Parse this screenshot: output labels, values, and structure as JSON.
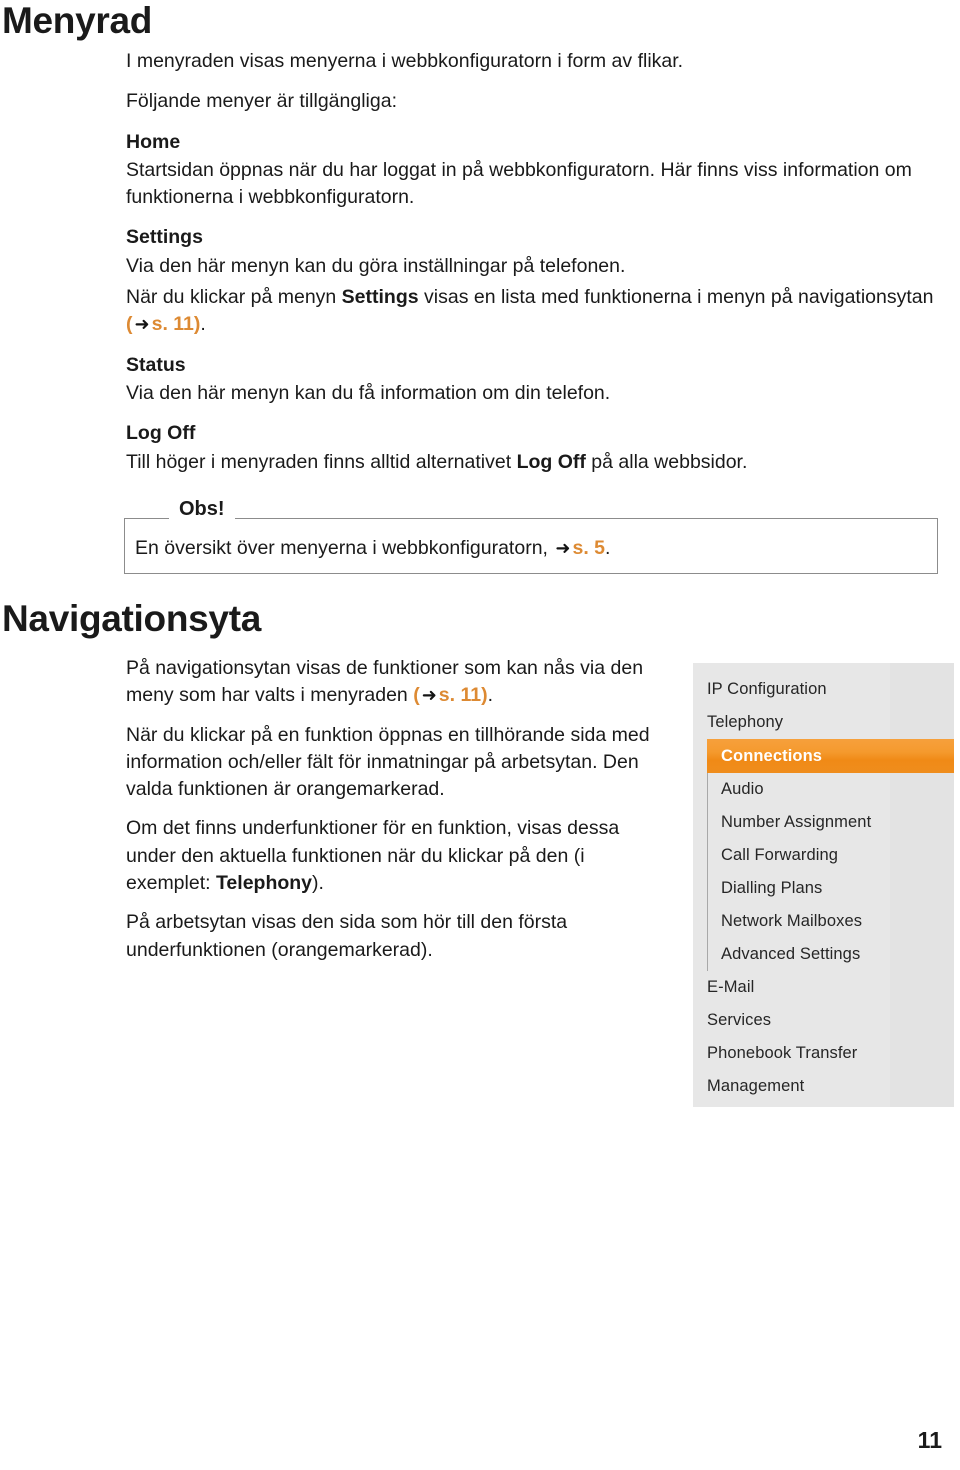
{
  "document": {
    "page_number": "11",
    "accent_color": "#dd8a33",
    "highlight_color": "#f59a2e",
    "panel_bg": "#e7e7e7"
  },
  "sections": {
    "menyrad": {
      "title": "Menyrad",
      "intro": "I menyraden visas menyerna i webbkonfiguratorn i form av flikar.",
      "lead": "Följande menyer är tillgängliga:",
      "entries": [
        {
          "term": "Home",
          "desc": "Startsidan öppnas när du har loggat in på webbkonfiguratorn. Här finns viss information om funktionerna i webbkonfiguratorn."
        },
        {
          "term": "Settings",
          "desc": "Via den här menyn kan du göra inställningar på telefonen.",
          "desc2_pre": "När du klickar på menyn ",
          "desc2_bold": "Settings",
          "desc2_post": " visas en lista med funktionerna i menyn på navigationsytan ",
          "desc2_ref_open": "(",
          "desc2_ref_arrow": "➜",
          "desc2_ref_page": "s. 11)",
          "desc2_end": "."
        },
        {
          "term": "Status",
          "desc": "Via den här menyn kan du få information om din telefon."
        },
        {
          "term": "Log Off",
          "desc_pre": "Till höger i menyraden finns alltid alternativet ",
          "desc_bold": "Log Off",
          "desc_post": " på alla webbsidor."
        }
      ],
      "note": {
        "legend": "Obs!",
        "text_pre": "En översikt över menyerna i webbkonfiguratorn, ",
        "arrow": "➜",
        "ref_page": "s. 5",
        "text_end": "."
      }
    },
    "navigationsyta": {
      "title": "Navigationsyta",
      "paragraphs": [
        {
          "pre": "På navigationsytan visas de funktioner som kan nås via den meny som har valts i menyraden ",
          "ref_open": "(",
          "arrow": "➜",
          "ref_page": "s. 11)",
          "post": "."
        },
        {
          "text": "När du klickar på en funktion öppnas en tillhörande sida med information och/eller fält för inmatningar på arbetsytan. Den valda funktionen är orangemarkerad."
        },
        {
          "pre": "Om det finns underfunktioner för en funktion, visas dessa under den aktuella funktionen när du klickar på den (i exemplet: ",
          "bold": "Telephony",
          "post": ")."
        },
        {
          "text": "På arbetsytan visas den sida som hör till den första underfunktionen (orangemarkerad)."
        }
      ]
    }
  },
  "nav_panel": {
    "items": [
      {
        "label": "IP Configuration",
        "level": 0,
        "selected": false
      },
      {
        "label": "Telephony",
        "level": 0,
        "selected": false
      },
      {
        "label": "Connections",
        "level": 1,
        "selected": true
      },
      {
        "label": "Audio",
        "level": 1,
        "selected": false
      },
      {
        "label": "Number Assignment",
        "level": 1,
        "selected": false
      },
      {
        "label": "Call Forwarding",
        "level": 1,
        "selected": false
      },
      {
        "label": "Dialling Plans",
        "level": 1,
        "selected": false
      },
      {
        "label": "Network Mailboxes",
        "level": 1,
        "selected": false
      },
      {
        "label": "Advanced Settings",
        "level": 1,
        "selected": false
      },
      {
        "label": "E-Mail",
        "level": 0,
        "selected": false
      },
      {
        "label": "Services",
        "level": 0,
        "selected": false
      },
      {
        "label": "Phonebook Transfer",
        "level": 0,
        "selected": false
      },
      {
        "label": "Management",
        "level": 0,
        "selected": false
      }
    ]
  }
}
